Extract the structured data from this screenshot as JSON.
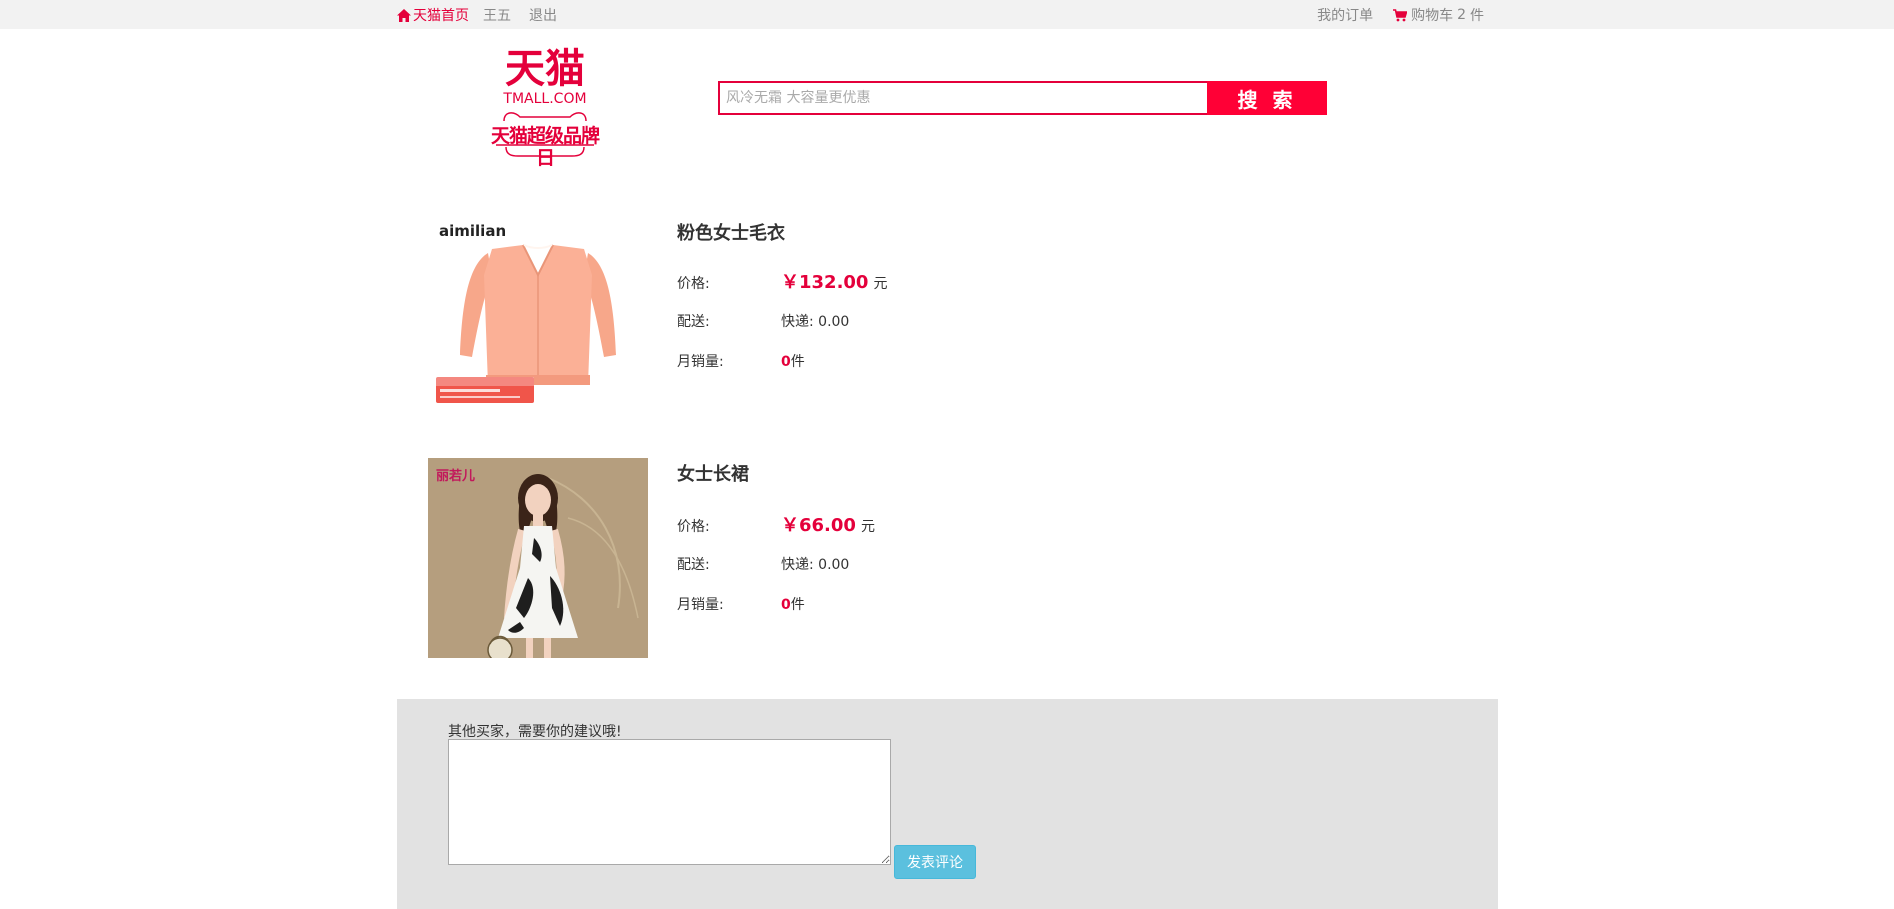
{
  "topbar": {
    "home_label": "天猫首页",
    "username": "王五",
    "logout_label": "退出",
    "orders_label": "我的订单",
    "cart_label": "购物车",
    "cart_count": "2",
    "cart_unit": "件"
  },
  "logo": {
    "main": "天猫",
    "domain": "TMALL.COM",
    "sub": "天猫超级品牌日"
  },
  "search": {
    "placeholder": "风冷无霜 大容量更优惠",
    "button_label": "搜 索"
  },
  "labels": {
    "price": "价格:",
    "shipping": "配送:",
    "monthly_sales": "月销量:",
    "currency_symbol": "￥",
    "currency_unit": "元",
    "pieces_unit": "件"
  },
  "products": [
    {
      "title": "粉色女士毛衣",
      "price": "132.00",
      "shipping": "快递: 0.00",
      "monthly_sales": "0",
      "brand": "aimilian"
    },
    {
      "title": "女士长裙",
      "price": "66.00",
      "shipping": "快递: 0.00",
      "monthly_sales": "0",
      "brand": "丽若儿"
    }
  ],
  "comment": {
    "label": "其他买家，需要你的建议哦!",
    "button_label": "发表评论"
  },
  "colors": {
    "accent": "#e4003b",
    "search_button": "#ff0036",
    "comment_button": "#5bc0de",
    "comment_bg": "#e2e2e2"
  }
}
